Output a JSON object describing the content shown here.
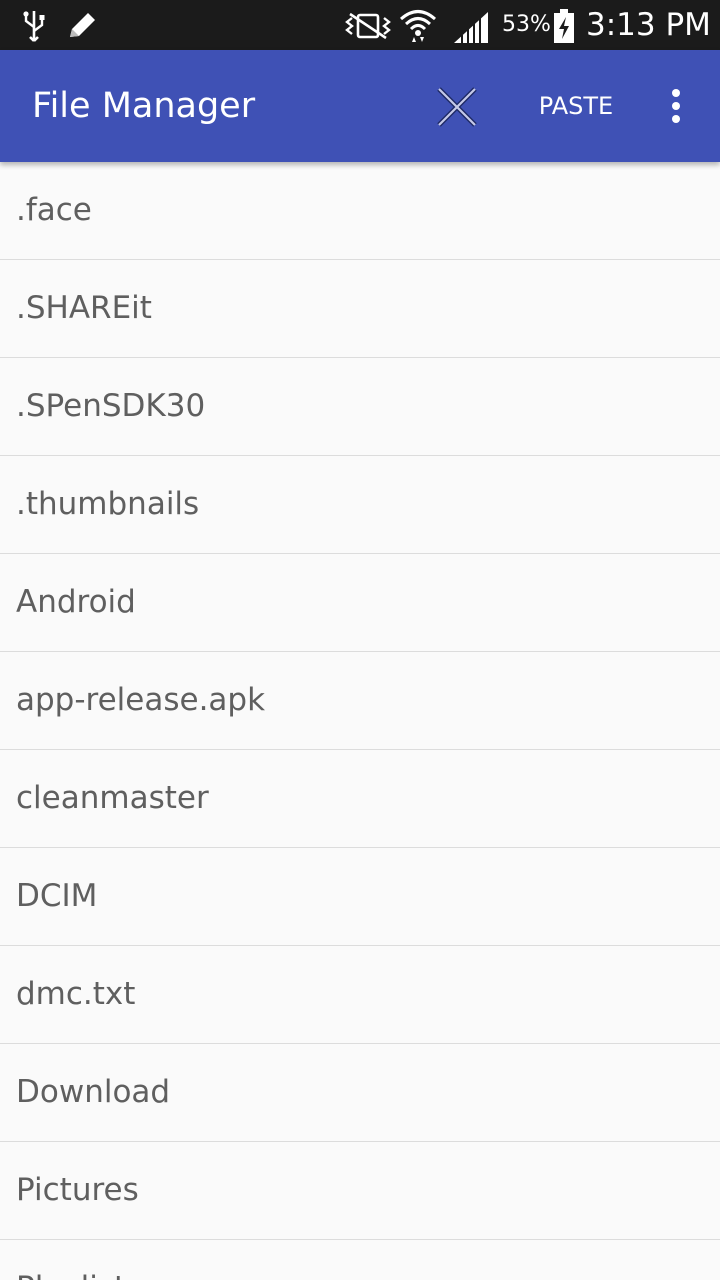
{
  "status_bar": {
    "icons": [
      "usb-icon",
      "edit-icon",
      "vibrate-icon",
      "wifi-icon",
      "signal-icon",
      "battery-charging-icon"
    ],
    "battery_percent": "53%",
    "time": "3:13 PM"
  },
  "app_bar": {
    "title": "File Manager",
    "close_icon": "close-icon",
    "paste_label": "PASTE",
    "overflow_icon": "more-vert-icon",
    "color": "#3f51b5"
  },
  "files": [
    ".face",
    ".SHAREit",
    ".SPenSDK30",
    ".thumbnails",
    "Android",
    "app-release.apk",
    "cleanmaster",
    "DCIM",
    "dmc.txt",
    "Download",
    "Pictures",
    "Playlist"
  ]
}
